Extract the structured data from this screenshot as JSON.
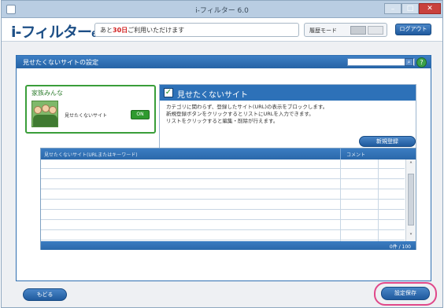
{
  "window": {
    "title": "i-フィルター 6.0"
  },
  "header": {
    "logo": "i-フィルター",
    "logo_suffix": "6",
    "days_prefix": "あと",
    "days_highlight": "30日",
    "days_suffix": "ご利用いただけます",
    "mode_label": "履歴モード",
    "logout_label": "ログアウト"
  },
  "panel": {
    "title": "見せたくないサイトの設定"
  },
  "profile": {
    "name": "家族みんな",
    "filter_label": "見せたくないサイト",
    "status": "ON"
  },
  "block": {
    "title": "見せたくないサイト",
    "description": [
      "カテゴリに関わらず、登録したサイト(URL)の表示をブロックします。",
      "新規登録ボタンをクリックするとリストにURLを入力できます。",
      "リストをクリックすると編集・削除が行えます。"
    ],
    "register_label": "新規登録"
  },
  "table": {
    "columns": [
      "見せたくないサイト(URLまたはキーワード)",
      "コメント"
    ],
    "count": "0件 / 100"
  },
  "footer": {
    "back_label": "もどる",
    "save_label": "設定保存"
  }
}
